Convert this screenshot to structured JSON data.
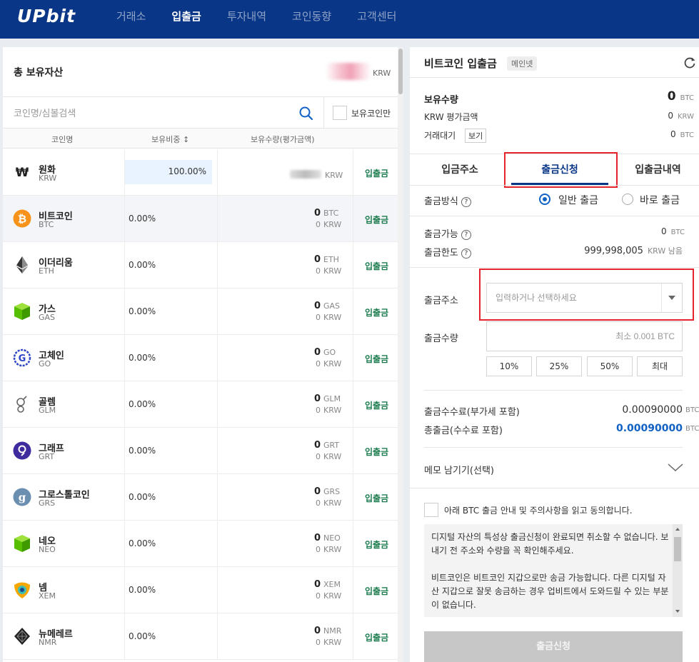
{
  "header": {
    "logo": "UPbit",
    "nav": [
      "거래소",
      "입출금",
      "투자내역",
      "코인동향",
      "고객센터"
    ],
    "active_nav": "입출금"
  },
  "assets": {
    "title": "총 보유자산",
    "total_unit": "KRW",
    "search_placeholder": "코인명/심볼검색",
    "own_only_label": "보유코인만",
    "columns": {
      "name": "코인명",
      "ratio": "보유비중 ↕",
      "qty": "보유수량(평가금액)"
    },
    "action_label": "입출금",
    "coins": [
      {
        "name": "원화",
        "symbol": "KRW",
        "ratio": "100.00%",
        "qty": "",
        "qty_unit": "",
        "krw": "",
        "krw_unit": "KRW",
        "icon": "won-icon"
      },
      {
        "name": "비트코인",
        "symbol": "BTC",
        "ratio": "0.00%",
        "qty": "0",
        "qty_unit": "BTC",
        "krw": "0",
        "krw_unit": "KRW",
        "icon": "bitcoin-icon"
      },
      {
        "name": "이더리움",
        "symbol": "ETH",
        "ratio": "0.00%",
        "qty": "0",
        "qty_unit": "ETH",
        "krw": "0",
        "krw_unit": "KRW",
        "icon": "ethereum-icon"
      },
      {
        "name": "가스",
        "symbol": "GAS",
        "ratio": "0.00%",
        "qty": "0",
        "qty_unit": "GAS",
        "krw": "0",
        "krw_unit": "KRW",
        "icon": "gas-icon"
      },
      {
        "name": "고체인",
        "symbol": "GO",
        "ratio": "0.00%",
        "qty": "0",
        "qty_unit": "GO",
        "krw": "0",
        "krw_unit": "KRW",
        "icon": "gochain-icon"
      },
      {
        "name": "골렘",
        "symbol": "GLM",
        "ratio": "0.00%",
        "qty": "0",
        "qty_unit": "GLM",
        "krw": "0",
        "krw_unit": "KRW",
        "icon": "golem-icon"
      },
      {
        "name": "그래프",
        "symbol": "GRT",
        "ratio": "0.00%",
        "qty": "0",
        "qty_unit": "GRT",
        "krw": "0",
        "krw_unit": "KRW",
        "icon": "graph-icon"
      },
      {
        "name": "그로스톨코인",
        "symbol": "GRS",
        "ratio": "0.00%",
        "qty": "0",
        "qty_unit": "GRS",
        "krw": "0",
        "krw_unit": "KRW",
        "icon": "groestlcoin-icon"
      },
      {
        "name": "네오",
        "symbol": "NEO",
        "ratio": "0.00%",
        "qty": "0",
        "qty_unit": "NEO",
        "krw": "0",
        "krw_unit": "KRW",
        "icon": "neo-icon"
      },
      {
        "name": "넴",
        "symbol": "XEM",
        "ratio": "0.00%",
        "qty": "0",
        "qty_unit": "XEM",
        "krw": "0",
        "krw_unit": "KRW",
        "icon": "nem-icon"
      },
      {
        "name": "뉴메레르",
        "symbol": "NMR",
        "ratio": "0.00%",
        "qty": "0",
        "qty_unit": "NMR",
        "krw": "0",
        "krw_unit": "KRW",
        "icon": "numeraire-icon"
      }
    ]
  },
  "withdraw": {
    "title": "비트코인 입출금",
    "network_badge": "메인넷",
    "balance_label": "보유수량",
    "balance_value": "0",
    "balance_unit": "BTC",
    "krw_eval_label": "KRW 평가금액",
    "krw_eval_value": "0",
    "krw_eval_unit": "KRW",
    "pending_label": "거래대기",
    "pending_view": "보기",
    "pending_value": "0",
    "pending_unit": "BTC",
    "tabs": [
      "입금주소",
      "출금신청",
      "입출금내역"
    ],
    "active_tab": "출금신청",
    "method_label": "출금방식",
    "method_options": [
      "일반 출금",
      "바로 출금"
    ],
    "available_label": "출금가능",
    "available_value": "0",
    "available_unit": "BTC",
    "limit_label": "출금한도",
    "limit_value": "999,998,005",
    "limit_unit": "KRW 남음",
    "address_label": "출금주소",
    "address_placeholder": "입력하거나 선택하세요",
    "amount_label": "출금수량",
    "amount_placeholder": "최소 0.001 BTC",
    "pct_buttons": [
      "10%",
      "25%",
      "50%",
      "최대"
    ],
    "fee_label": "출금수수료(부가세 포함)",
    "fee_value": "0.00090000",
    "fee_unit": "BTC",
    "total_label": "총출금(수수료 포함)",
    "total_value": "0.00090000",
    "total_unit": "BTC",
    "memo_label": "메모 남기기(선택)",
    "agree_text": "아래 BTC 출금 안내 및 주의사항을 읽고 동의합니다.",
    "notice_1": "디지털 자산의 특성상 출금신청이 완료되면 취소할 수 없습니다. 보내기 전 주소와 수량을 꼭 확인해주세요.",
    "notice_2": "비트코인은 비트코인 지갑으로만 송금 가능합니다. 다른 디지털 자산 지갑으로 잘못 송금하는 경우 업비트에서 도와드릴 수 있는 부분이 없습니다.",
    "submit_label": "출금신청"
  },
  "colors": {
    "brand": "#093687",
    "highlight": "#e5242b",
    "accent_blue": "#1261c4",
    "action_green": "#1c7c4e"
  }
}
